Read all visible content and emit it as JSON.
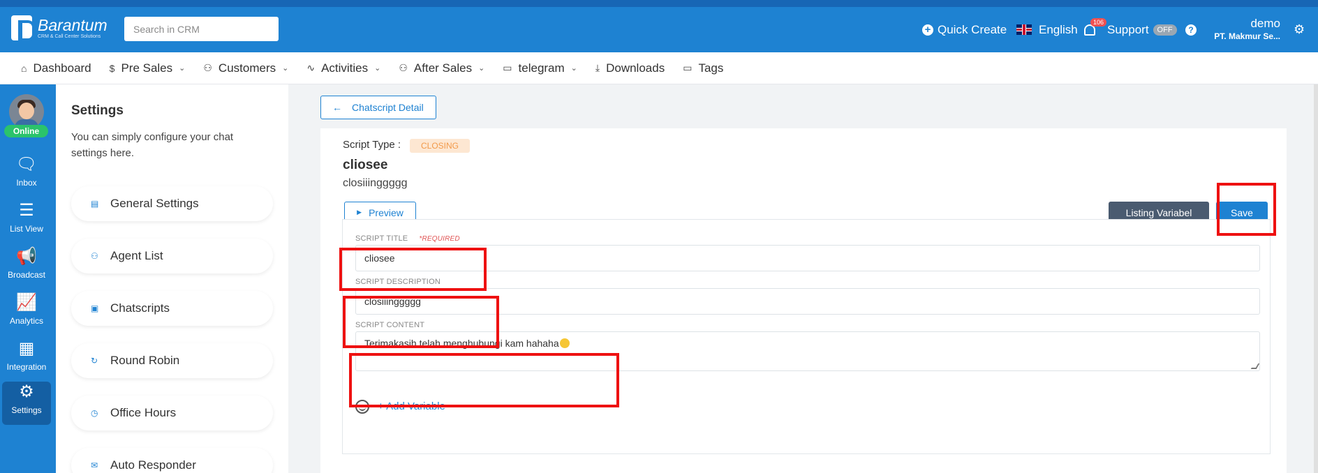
{
  "app": {
    "logo_name": "Barantum",
    "logo_sub": "CRM & Call Center Solutions",
    "search_placeholder": "Search in CRM"
  },
  "topbar": {
    "quick_create": "Quick Create",
    "language": "English",
    "notifications": "106",
    "support": "Support",
    "support_toggle": "OFF",
    "help": "?",
    "user_name": "demo",
    "user_org": "PT. Makmur Se..."
  },
  "nav": {
    "items": [
      {
        "icon": "⌂",
        "label": "Dashboard",
        "caret": ""
      },
      {
        "icon": "$",
        "label": "Pre Sales",
        "caret": "⌄"
      },
      {
        "icon": "⚇",
        "label": "Customers",
        "caret": "⌄"
      },
      {
        "icon": "∿",
        "label": "Activities",
        "caret": "⌄"
      },
      {
        "icon": "⚇",
        "label": "After Sales",
        "caret": "⌄"
      },
      {
        "icon": "▭",
        "label": "telegram",
        "caret": "⌄"
      },
      {
        "icon": "⤓",
        "label": "Downloads",
        "caret": ""
      },
      {
        "icon": "▭",
        "label": "Tags",
        "caret": ""
      }
    ]
  },
  "rail": {
    "status": "Online",
    "items": [
      {
        "icon": "🗨",
        "label": "Inbox"
      },
      {
        "icon": "☰",
        "label": "List View"
      },
      {
        "icon": "📢",
        "label": "Broadcast"
      },
      {
        "icon": "📈",
        "label": "Analytics"
      },
      {
        "icon": "▦",
        "label": "Integration"
      },
      {
        "icon": "⚙",
        "label": "Settings"
      }
    ]
  },
  "settings": {
    "title": "Settings",
    "description": "You can simply configure your chat settings here.",
    "items": [
      {
        "icon": "▤",
        "label": "General Settings"
      },
      {
        "icon": "⚇",
        "label": "Agent List"
      },
      {
        "icon": "▣",
        "label": "Chatscripts"
      },
      {
        "icon": "↻",
        "label": "Round Robin"
      },
      {
        "icon": "◷",
        "label": "Office Hours"
      },
      {
        "icon": "✉",
        "label": "Auto Responder"
      }
    ]
  },
  "main": {
    "back_label": "Chatscript Detail",
    "script_type_label": "Script Type :",
    "script_type_value": "CLOSING",
    "script_name": "cliosee",
    "script_desc": "closiiinggggg",
    "preview_label": "Preview",
    "listing_label": "Listing Variabel",
    "save_label": "Save",
    "form": {
      "title_label": "SCRIPT TITLE",
      "required_label": "*REQUIRED",
      "title_value": "cliosee",
      "desc_label": "SCRIPT DESCRIPTION",
      "desc_value": "closiiinggggg",
      "content_label": "SCRIPT CONTENT",
      "content_value": "Terimakasih telah menghubungi kam hahaha",
      "add_variable": "+ Add Variable"
    }
  },
  "colors": {
    "brand": "#1e82d2",
    "highlight": "#ee1111",
    "online": "#2bc36b",
    "badge": "#f05050"
  }
}
